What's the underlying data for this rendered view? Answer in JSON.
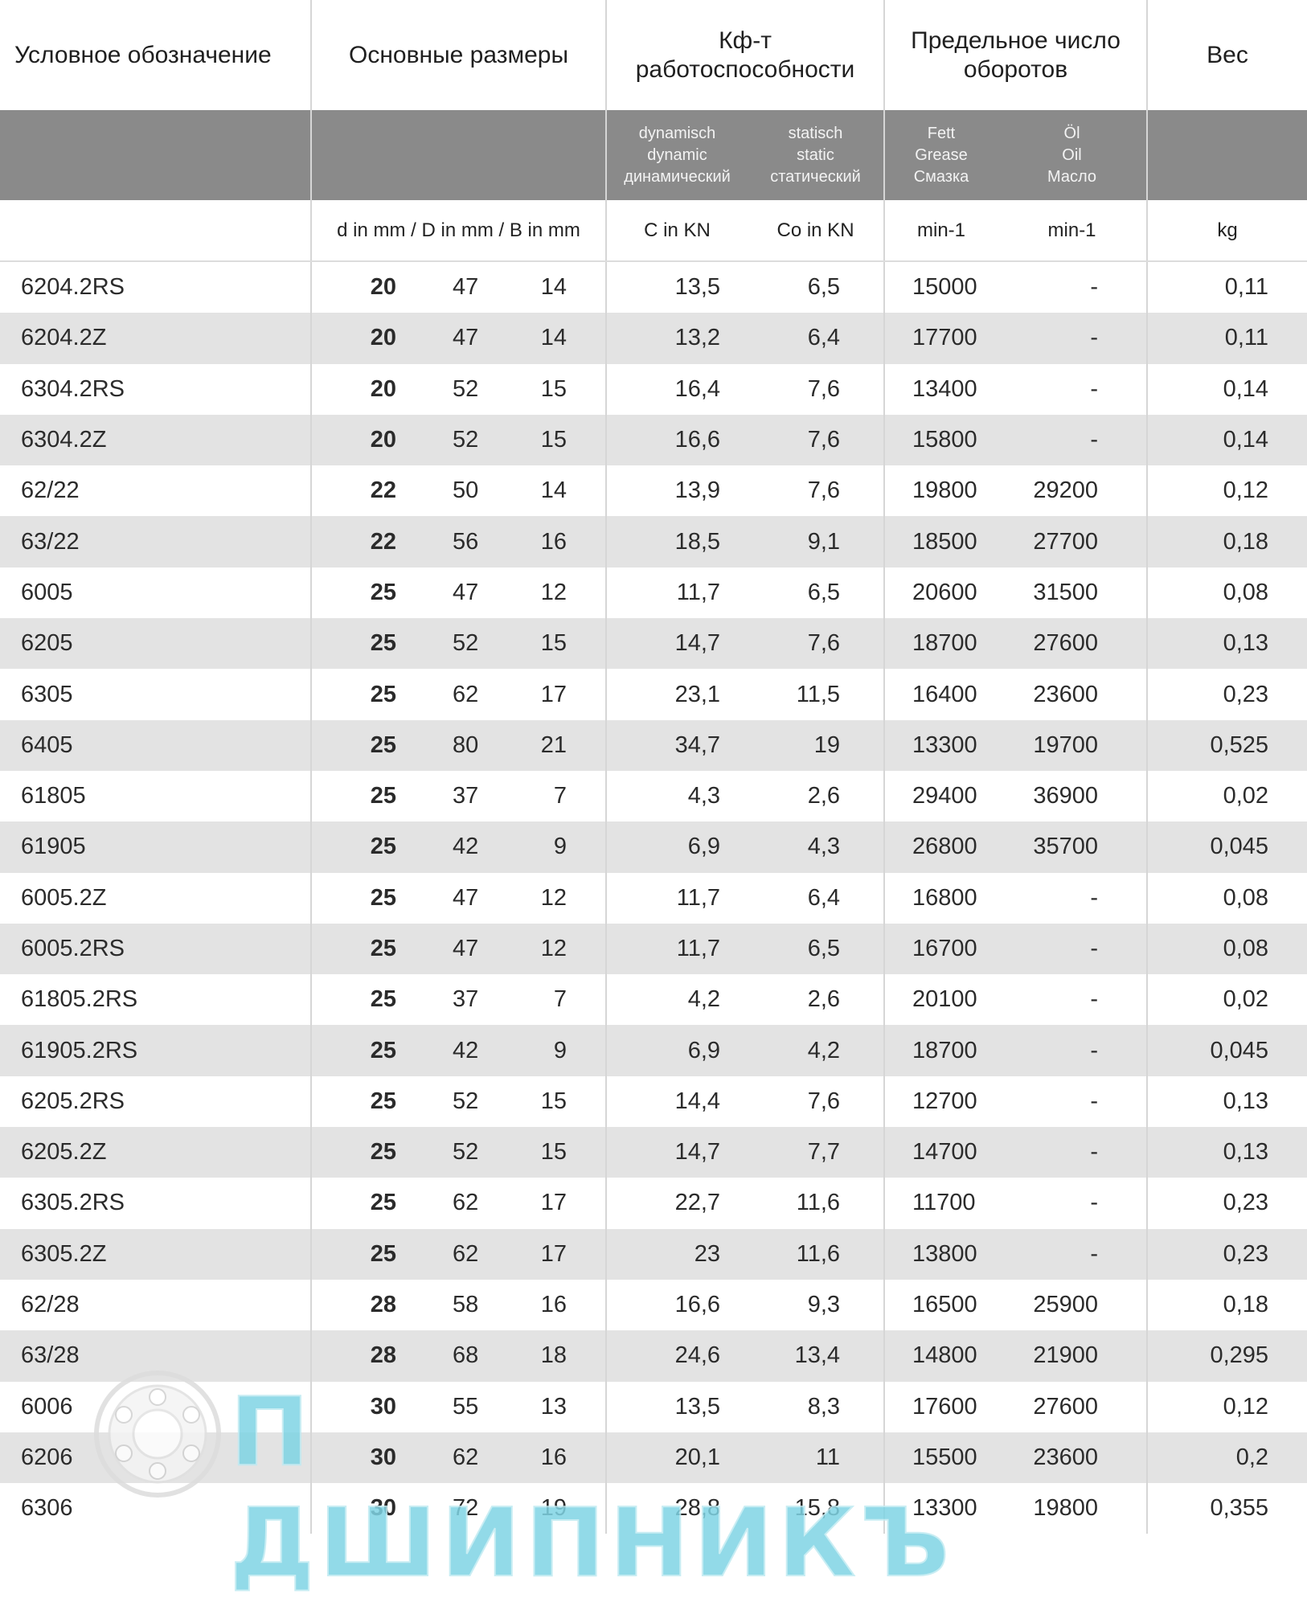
{
  "header": {
    "designation": "Условное обозначение",
    "dimensions": "Основные размеры",
    "capacity_line1": "Кф-т",
    "capacity_line2": "работоспособности",
    "speed_line1": "Предельное число",
    "speed_line2": "оборотов",
    "weight": "Вес"
  },
  "subheader": {
    "dynamic": [
      "dynamisch",
      "dynamic",
      "динамический"
    ],
    "static": [
      "statisch",
      "static",
      "статический"
    ],
    "grease": [
      "Fett",
      "Grease",
      "Смазка"
    ],
    "oil": [
      "Öl",
      "Oil",
      "Масло"
    ]
  },
  "units": {
    "dimensions": "d in mm / D in mm / B in mm",
    "c": "C in KN",
    "co": "Co in KN",
    "grease": "min-1",
    "oil": "min-1",
    "weight": "kg"
  },
  "rows": [
    {
      "code": "6204.2RS",
      "d": "20",
      "D": "47",
      "B": "14",
      "C": "13,5",
      "Co": "6,5",
      "fett": "15000",
      "oil": "-",
      "kg": "0,11"
    },
    {
      "code": "6204.2Z",
      "d": "20",
      "D": "47",
      "B": "14",
      "C": "13,2",
      "Co": "6,4",
      "fett": "17700",
      "oil": "-",
      "kg": "0,11"
    },
    {
      "code": "6304.2RS",
      "d": "20",
      "D": "52",
      "B": "15",
      "C": "16,4",
      "Co": "7,6",
      "fett": "13400",
      "oil": "-",
      "kg": "0,14"
    },
    {
      "code": "6304.2Z",
      "d": "20",
      "D": "52",
      "B": "15",
      "C": "16,6",
      "Co": "7,6",
      "fett": "15800",
      "oil": "-",
      "kg": "0,14"
    },
    {
      "code": "62/22",
      "d": "22",
      "D": "50",
      "B": "14",
      "C": "13,9",
      "Co": "7,6",
      "fett": "19800",
      "oil": "29200",
      "kg": "0,12"
    },
    {
      "code": "63/22",
      "d": "22",
      "D": "56",
      "B": "16",
      "C": "18,5",
      "Co": "9,1",
      "fett": "18500",
      "oil": "27700",
      "kg": "0,18"
    },
    {
      "code": "6005",
      "d": "25",
      "D": "47",
      "B": "12",
      "C": "11,7",
      "Co": "6,5",
      "fett": "20600",
      "oil": "31500",
      "kg": "0,08"
    },
    {
      "code": "6205",
      "d": "25",
      "D": "52",
      "B": "15",
      "C": "14,7",
      "Co": "7,6",
      "fett": "18700",
      "oil": "27600",
      "kg": "0,13"
    },
    {
      "code": "6305",
      "d": "25",
      "D": "62",
      "B": "17",
      "C": "23,1",
      "Co": "11,5",
      "fett": "16400",
      "oil": "23600",
      "kg": "0,23"
    },
    {
      "code": "6405",
      "d": "25",
      "D": "80",
      "B": "21",
      "C": "34,7",
      "Co": "19",
      "fett": "13300",
      "oil": "19700",
      "kg": "0,525"
    },
    {
      "code": "61805",
      "d": "25",
      "D": "37",
      "B": "7",
      "C": "4,3",
      "Co": "2,6",
      "fett": "29400",
      "oil": "36900",
      "kg": "0,02"
    },
    {
      "code": "61905",
      "d": "25",
      "D": "42",
      "B": "9",
      "C": "6,9",
      "Co": "4,3",
      "fett": "26800",
      "oil": "35700",
      "kg": "0,045"
    },
    {
      "code": "6005.2Z",
      "d": "25",
      "D": "47",
      "B": "12",
      "C": "11,7",
      "Co": "6,4",
      "fett": "16800",
      "oil": "-",
      "kg": "0,08"
    },
    {
      "code": "6005.2RS",
      "d": "25",
      "D": "47",
      "B": "12",
      "C": "11,7",
      "Co": "6,5",
      "fett": "16700",
      "oil": "-",
      "kg": "0,08"
    },
    {
      "code": "61805.2RS",
      "d": "25",
      "D": "37",
      "B": "7",
      "C": "4,2",
      "Co": "2,6",
      "fett": "20100",
      "oil": "-",
      "kg": "0,02"
    },
    {
      "code": "61905.2RS",
      "d": "25",
      "D": "42",
      "B": "9",
      "C": "6,9",
      "Co": "4,2",
      "fett": "18700",
      "oil": "-",
      "kg": "0,045"
    },
    {
      "code": "6205.2RS",
      "d": "25",
      "D": "52",
      "B": "15",
      "C": "14,4",
      "Co": "7,6",
      "fett": "12700",
      "oil": "-",
      "kg": "0,13"
    },
    {
      "code": "6205.2Z",
      "d": "25",
      "D": "52",
      "B": "15",
      "C": "14,7",
      "Co": "7,7",
      "fett": "14700",
      "oil": "-",
      "kg": "0,13"
    },
    {
      "code": "6305.2RS",
      "d": "25",
      "D": "62",
      "B": "17",
      "C": "22,7",
      "Co": "11,6",
      "fett": "11700",
      "oil": "-",
      "kg": "0,23"
    },
    {
      "code": "6305.2Z",
      "d": "25",
      "D": "62",
      "B": "17",
      "C": "23",
      "Co": "11,6",
      "fett": "13800",
      "oil": "-",
      "kg": "0,23"
    },
    {
      "code": "62/28",
      "d": "28",
      "D": "58",
      "B": "16",
      "C": "16,6",
      "Co": "9,3",
      "fett": "16500",
      "oil": "25900",
      "kg": "0,18"
    },
    {
      "code": "63/28",
      "d": "28",
      "D": "68",
      "B": "18",
      "C": "24,6",
      "Co": "13,4",
      "fett": "14800",
      "oil": "21900",
      "kg": "0,295"
    },
    {
      "code": "6006",
      "d": "30",
      "D": "55",
      "B": "13",
      "C": "13,5",
      "Co": "8,3",
      "fett": "17600",
      "oil": "27600",
      "kg": "0,12"
    },
    {
      "code": "6206",
      "d": "30",
      "D": "62",
      "B": "16",
      "C": "20,1",
      "Co": "11",
      "fett": "15500",
      "oil": "23600",
      "kg": "0,2"
    },
    {
      "code": "6306",
      "d": "30",
      "D": "72",
      "B": "19",
      "C": "28,8",
      "Co": "15,8",
      "fett": "13300",
      "oil": "19800",
      "kg": "0,355"
    }
  ],
  "watermark": {
    "text": "П  ДШИПНИКЪ",
    "color": "#7fd4e4"
  }
}
